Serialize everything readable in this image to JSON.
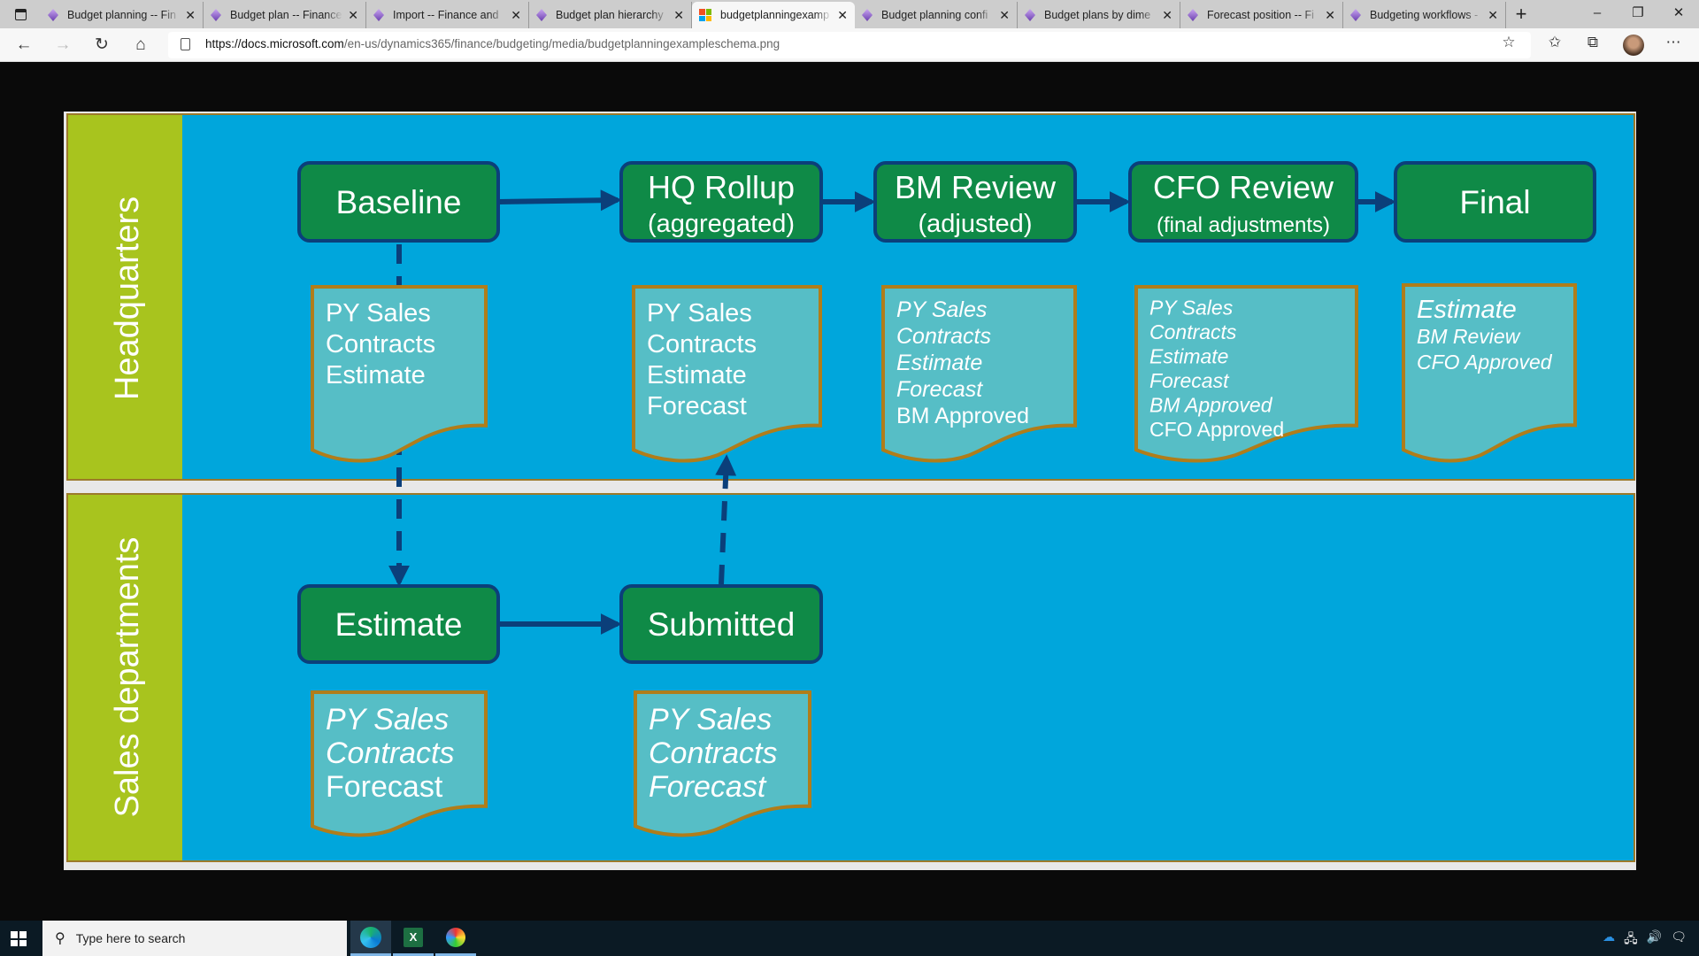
{
  "browser": {
    "tabs": [
      {
        "title": "Budget planning -- Fin",
        "active": false
      },
      {
        "title": "Budget plan -- Finance",
        "active": false
      },
      {
        "title": "Import -- Finance and",
        "active": false
      },
      {
        "title": "Budget plan hierarchy",
        "active": false
      },
      {
        "title": "budgetplanningexamp",
        "active": true
      },
      {
        "title": "Budget planning confi",
        "active": false
      },
      {
        "title": "Budget plans by dime",
        "active": false
      },
      {
        "title": "Forecast position -- Fi",
        "active": false
      },
      {
        "title": "Budgeting workflows -",
        "active": false
      }
    ],
    "url_domain": "https://docs.microsoft.com",
    "url_path": "/en-us/dynamics365/finance/budgeting/media/budgetplanningexampleschema.png"
  },
  "diagram": {
    "colors": {
      "lane": "#00a6dc",
      "lane_label": "#a8c41e",
      "step": "#0f8a47",
      "step_border": "#0b3f7a",
      "doc": "#56bec6",
      "doc_border": "#b07d1a",
      "arrow": "#0b3f7a"
    },
    "lanes": {
      "hq": "Headquarters",
      "sales": "Sales departments"
    },
    "steps": {
      "baseline": {
        "title": "Baseline"
      },
      "hq_rollup": {
        "title": "HQ Rollup",
        "subtitle": "(aggregated)"
      },
      "bm_review": {
        "title": "BM Review",
        "subtitle": "(adjusted)"
      },
      "cfo_review": {
        "title": "CFO Review",
        "subtitle": "(final adjustments)"
      },
      "final": {
        "title": "Final"
      },
      "estimate": {
        "title": "Estimate"
      },
      "submitted": {
        "title": "Submitted"
      }
    },
    "docs": {
      "baseline": [
        "PY Sales",
        "Contracts",
        "Estimate"
      ],
      "hq_rollup": [
        "PY Sales",
        "Contracts",
        "Estimate",
        "Forecast"
      ],
      "bm_review": [
        "PY Sales",
        "Contracts",
        "Estimate",
        "Forecast",
        "BM Approved"
      ],
      "cfo_review": [
        "PY Sales",
        "Contracts",
        "Estimate",
        "Forecast",
        "BM Approved",
        "CFO Approved"
      ],
      "final": [
        "Estimate",
        "BM Review",
        "CFO Approved"
      ],
      "estimate": [
        "PY Sales",
        "Contracts",
        "Forecast"
      ],
      "submitted": [
        "PY Sales",
        "Contracts",
        "Forecast"
      ]
    }
  },
  "taskbar": {
    "search_placeholder": "Type here to search"
  }
}
